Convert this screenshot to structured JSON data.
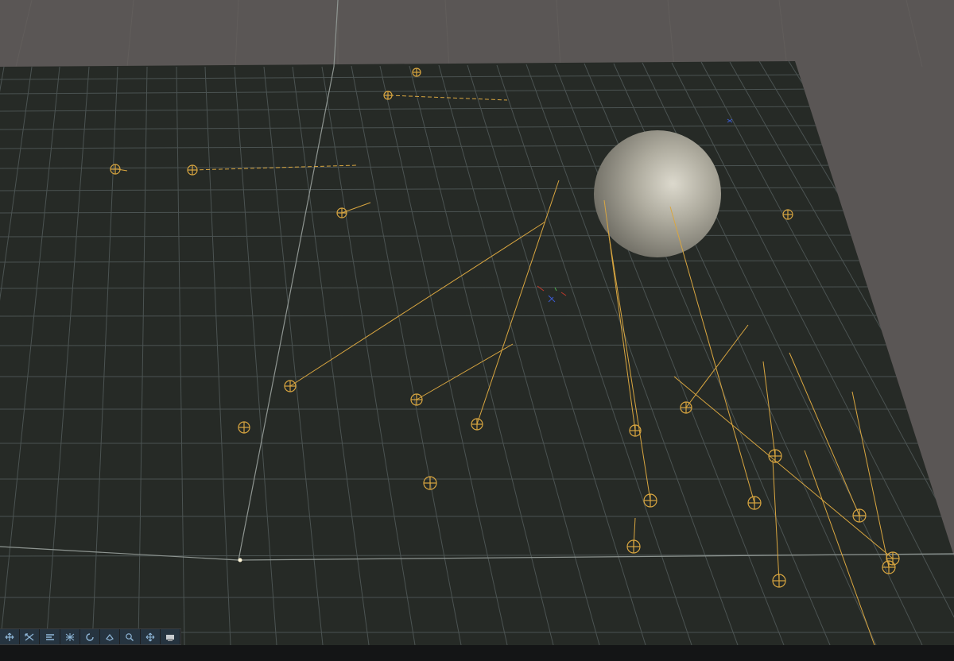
{
  "scene": {
    "sky_color": "#5a5655",
    "ground_color": "#262a26",
    "grid_color": "#4a5150",
    "gizmo_color": "#d9a640",
    "sphere_color": "#a8a598"
  },
  "toolbar": {
    "buttons": [
      {
        "icon": "move-arrows-icon"
      },
      {
        "icon": "scale-icon"
      },
      {
        "icon": "align-icon"
      },
      {
        "icon": "grid-snap-icon"
      },
      {
        "icon": "orbit-icon"
      },
      {
        "icon": "hand-pan-icon"
      },
      {
        "icon": "zoom-magnifier-icon"
      },
      {
        "icon": "pan-cross-icon"
      },
      {
        "icon": "camera-icon"
      }
    ]
  }
}
